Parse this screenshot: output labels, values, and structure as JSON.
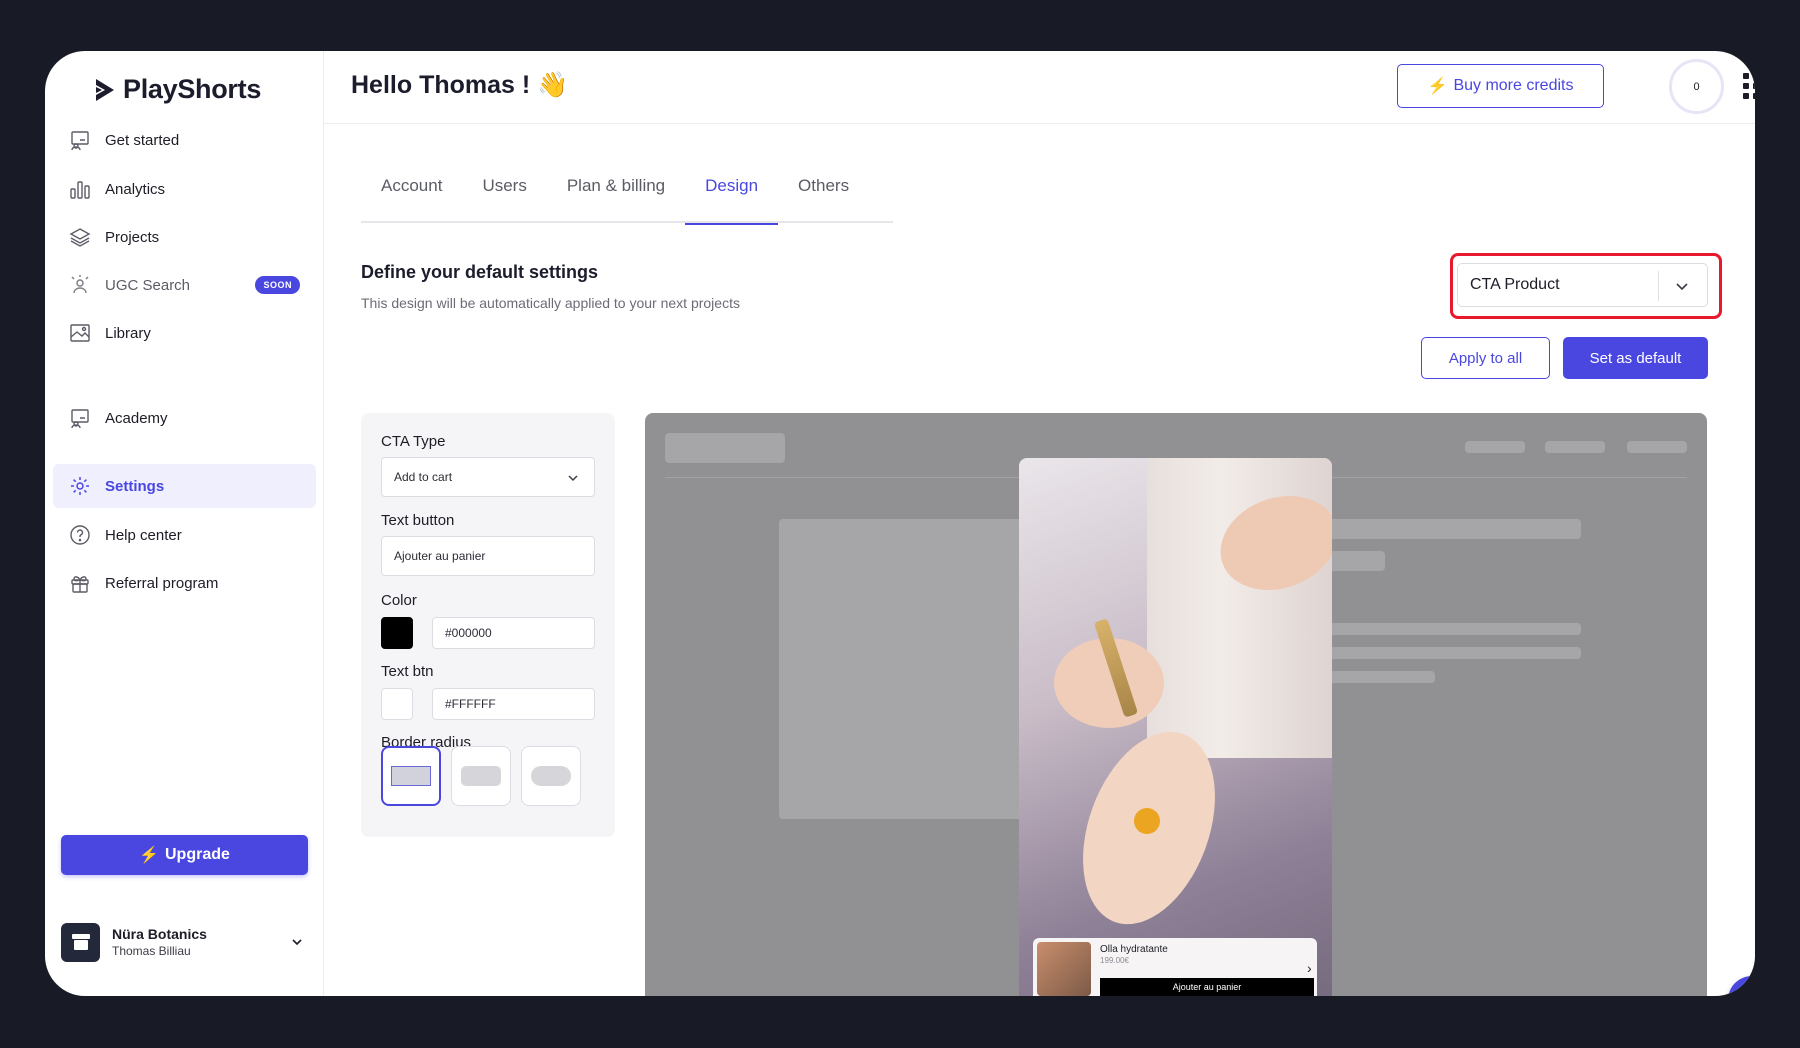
{
  "brand": {
    "name": "PlayShorts"
  },
  "sidebar": {
    "items": [
      {
        "label": "Get started"
      },
      {
        "label": "Analytics"
      },
      {
        "label": "Projects"
      },
      {
        "label": "UGC Search",
        "badge": "SOON"
      },
      {
        "label": "Library"
      },
      {
        "label": "Academy"
      },
      {
        "label": "Settings"
      },
      {
        "label": "Help center"
      },
      {
        "label": "Referral program"
      }
    ],
    "upgrade_label": "Upgrade",
    "account": {
      "name": "Nüra Botanics",
      "user": "Thomas Billiau"
    }
  },
  "header": {
    "greeting": "Hello Thomas ! 👋",
    "buy_credits_label": "Buy more credits",
    "credits": "0"
  },
  "tabs": [
    {
      "label": "Account"
    },
    {
      "label": "Users"
    },
    {
      "label": "Plan & billing"
    },
    {
      "label": "Design"
    },
    {
      "label": "Others"
    }
  ],
  "section": {
    "title": "Define your default settings",
    "subtitle": "This design will be automatically applied to your next projects",
    "preset_selected": "CTA Product",
    "apply_all_label": "Apply to all",
    "set_default_label": "Set as default"
  },
  "form": {
    "cta_type_label": "CTA Type",
    "cta_type_value": "Add to cart",
    "text_button_label": "Text button",
    "text_button_value": "Ajouter au panier",
    "color_label": "Color",
    "color_value": "#000000",
    "text_btn_label": "Text btn",
    "text_btn_value": "#FFFFFF",
    "border_radius_label": "Border radius"
  },
  "preview": {
    "product_name": "Olla hydratante",
    "product_price": "199.00€",
    "cta_text": "Ajouter au panier"
  },
  "colors": {
    "accent": "#4a47e0",
    "highlight": "#e8192c"
  }
}
